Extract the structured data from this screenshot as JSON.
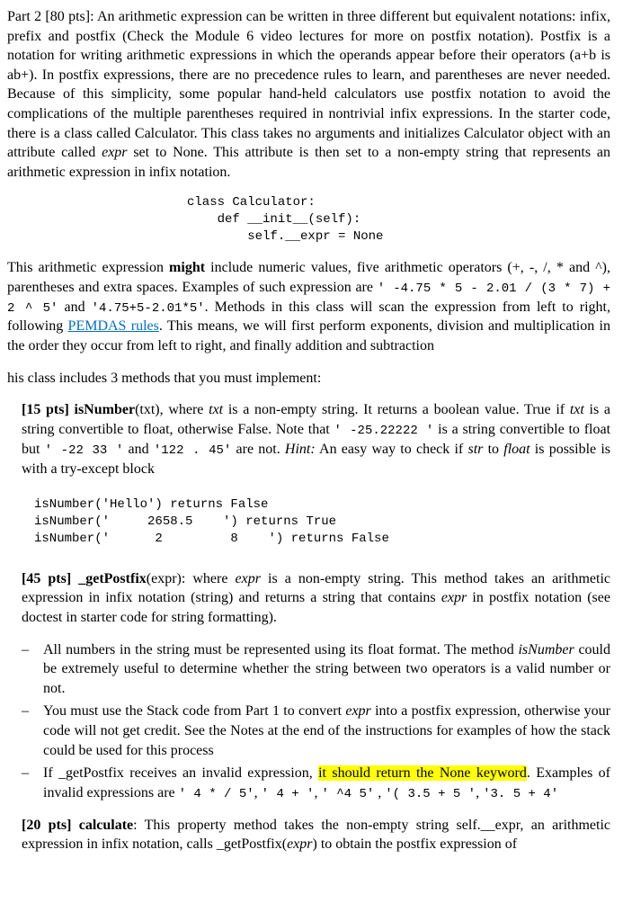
{
  "para1": {
    "prefix": "Part 2 [80 pts]: An arithmetic expression can be written in three different but equivalent notations: infix, prefix and postfix (Check the Module 6 video lectures for more on postfix notation). Postfix is a notation for writing arithmetic expressions in which the operands appear before their operators (a+b is ab+). In postfix expressions, there are no precedence rules to learn, and parentheses are never needed. Because of this simplicity, some popular hand-held calculators use postfix notation to avoid the complications of the multiple parentheses required in nontrivial infix expressions. In the starter code, there is a class called Calculator. This class takes no arguments and initializes Calculator object with an attribute called ",
    "expr_word": "expr",
    "suffix": " set to None. This attribute is then set to a non-empty string that represents an arithmetic expression in infix notation."
  },
  "code1": "class Calculator:\n    def __init__(self):\n        self.__expr = None",
  "para2": {
    "s1": "This arithmetic expression ",
    "bold1": "might",
    "s2": " include numeric values, five arithmetic operators (+, -, /, * and ^), parentheses and extra spaces. Examples of such expression are ",
    "c1": "'  -4.75    *      5 -  2.01  /   (3  *  7) +      2    ^      5'",
    "s3": " and ",
    "c2": "'4.75+5-2.01*5'",
    "s4": ". Methods in this class will scan the expression from left to right, following ",
    "link": "PEMDAS rules",
    "s5": ". This means, we will first perform exponents, division and multiplication in the order they occur from left to right,  and finally addition and subtraction"
  },
  "subhead1": "his class includes 3 methods that you must implement:",
  "isNumber": {
    "pts": "[15 pts] isNumber",
    "s1": "(txt), where ",
    "txt1": "txt",
    "s2": " is a non-empty string. It returns a boolean value. True if ",
    "txt2": "txt",
    "s3": " is a string convertible to float, otherwise False. Note that ",
    "c1": "'  -25.22222 '",
    "s4": " is a string convertible to float but ",
    "c2": "'  -22    33 '",
    "s5": " and ",
    "c3": "'122 .  45'",
    "s6": " are not. ",
    "hint": "Hint:",
    "s7": " An easy way to check if ",
    "str": "str",
    "s8": " to ",
    "float": "float",
    "s9": " is possible is with a try-except block"
  },
  "isNumber_examples": "isNumber('Hello') returns False\nisNumber('     2658.5    ') returns True\nisNumber('      2         8    ') returns False",
  "getPostfix": {
    "pts": "[45 pts] _getPostfix",
    "s1": "(expr): where ",
    "expr": "expr",
    "s2": " is a non-empty string. This method takes an arithmetic expression in infix notation (string) and returns a string that contains ",
    "expr2": "expr",
    "s3": " in postfix notation (see doctest in starter code for string formatting)."
  },
  "gp_b1": {
    "s1": "All numbers in the string must be represented using its float format. The method ",
    "isn": "isNumber",
    "s2": " could be extremely useful to determine whether the string between two operators is a valid number or not."
  },
  "gp_b2": {
    "s1": "You must use the Stack code from Part 1 to convert ",
    "expr": "expr",
    "s2": " into a postfix expression, otherwise your code will not get credit. See the Notes at the end of the instructions for examples of how the stack could be used for this process"
  },
  "gp_b3": {
    "s1": "If _getPostfix receives an invalid expression, ",
    "hl": "it should return the None keyword",
    "s2": ". Examples of invalid expressions are ",
    "c1": "'   4  *  /  5'",
    "s3": ", ",
    "c2": "' 4   +  '",
    "s4": ", ",
    "c3": "'   ^4 5'",
    "s5": " , ",
    "c4": "'( 3.5 + 5 '",
    "s6": ", ",
    "c5": "'3.     5 + 4'"
  },
  "calculate": {
    "pts": "[20 pts] calculate",
    "s1": ": This property method takes the non-empty string self.__expr, an arithmetic expression in infix notation, calls _getPostfix(",
    "expr": "expr",
    "s2": ") to obtain the postfix expression of"
  }
}
